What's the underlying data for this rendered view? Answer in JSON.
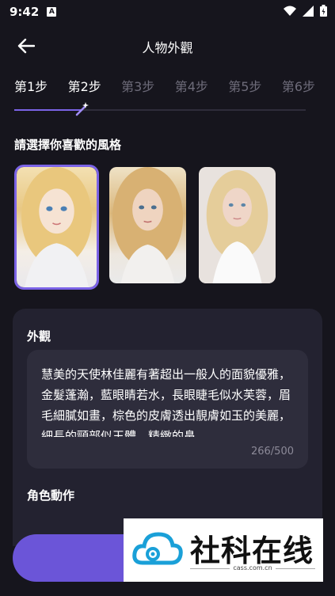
{
  "status_bar": {
    "time": "9:42",
    "notification_letter": "A"
  },
  "header": {
    "title": "人物外觀"
  },
  "steps": [
    {
      "label": "第1步",
      "state": "done"
    },
    {
      "label": "第2步",
      "state": "current"
    },
    {
      "label": "第3步",
      "state": "pending"
    },
    {
      "label": "第4步",
      "state": "pending"
    },
    {
      "label": "第5步",
      "state": "pending"
    },
    {
      "label": "第6步",
      "state": "pending"
    }
  ],
  "progress": {
    "fraction": 0.23
  },
  "style_section": {
    "title": "請選擇你喜歡的風格",
    "options": [
      {
        "name": "anime-style",
        "selected": true
      },
      {
        "name": "semi-realistic-style",
        "selected": false
      },
      {
        "name": "realistic-style",
        "selected": false
      }
    ]
  },
  "appearance": {
    "title": "外觀",
    "text": "慧美的天使林佳麗有著超出一般人的面貌優雅，金髮蓬瀚，藍眼睛若水，長眼睫毛似水芙蓉，眉毛細膩如畫，棕色的皮膚透出靚膚如玉的美麗，細長的頸部似玉體，精緻的鼻",
    "counter": "266/500"
  },
  "action": {
    "title": "角色動作"
  },
  "watermark": {
    "brand": "社科在线",
    "domain": "cass.com.cn"
  },
  "colors": {
    "accent": "#7b63e6",
    "background": "#16151d",
    "panel": "#232230"
  }
}
